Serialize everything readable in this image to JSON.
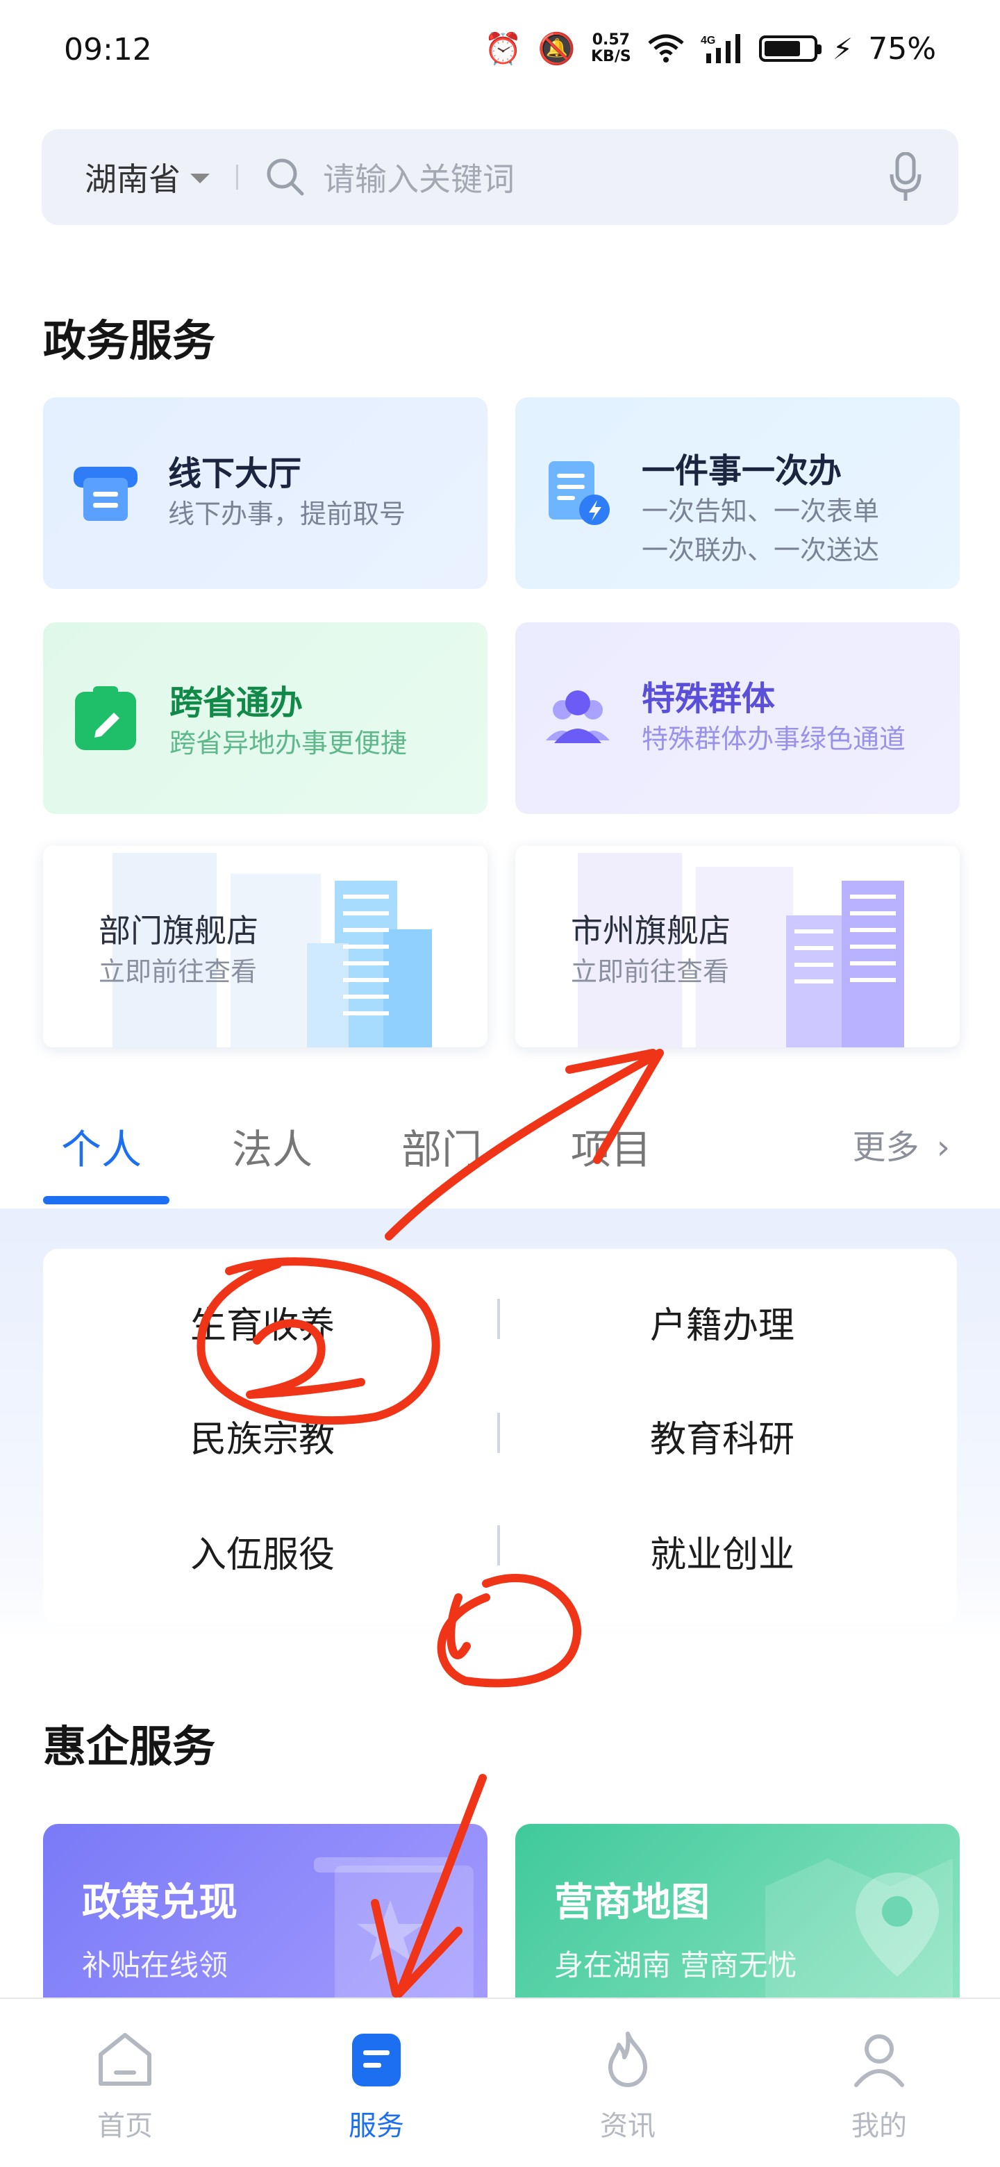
{
  "status_bar": {
    "time": "09:12",
    "net_speed_value": "0.57",
    "net_speed_unit": "KB/S",
    "network": "4G",
    "battery": "75%",
    "battery_level": 0.75
  },
  "search": {
    "region": "湖南省",
    "placeholder": "请输入关键词"
  },
  "gov_section": {
    "title": "政务服务",
    "cards": [
      {
        "title": "线下大厅",
        "sub": "线下办事，提前取号"
      },
      {
        "title": "一件事一次办",
        "sub1": "一次告知、一次表单",
        "sub2": "一次联办、一次送达"
      },
      {
        "title": "跨省通办",
        "sub": "跨省异地办事更便捷"
      },
      {
        "title": "特殊群体",
        "sub": "特殊群体办事绿色通道"
      }
    ],
    "stores": [
      {
        "title": "部门旗舰店",
        "sub": "立即前往查看"
      },
      {
        "title": "市州旗舰店",
        "sub": "立即前往查看"
      }
    ]
  },
  "tabs": {
    "items": [
      "个人",
      "法人",
      "部门",
      "项目"
    ],
    "active": "个人",
    "more": "更多"
  },
  "personal": {
    "items": [
      "生育收养",
      "户籍办理",
      "民族宗教",
      "教育科研",
      "入伍服役",
      "就业创业"
    ]
  },
  "enterprise": {
    "title": "惠企服务",
    "cards": [
      {
        "title": "政策兑现",
        "sub": "补贴在线领"
      },
      {
        "title": "营商地图",
        "sub": "身在湖南 营商无忧"
      }
    ]
  },
  "bottom_nav": {
    "items": [
      "首页",
      "服务",
      "资讯",
      "我的"
    ],
    "active": "服务"
  },
  "annotations": {
    "mark_1": "1",
    "mark_2": "2"
  }
}
